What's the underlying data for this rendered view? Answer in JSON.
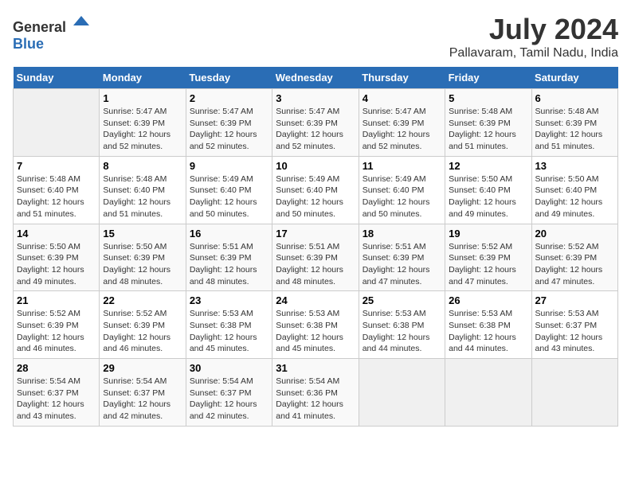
{
  "logo": {
    "general": "General",
    "blue": "Blue"
  },
  "title": {
    "month_year": "July 2024",
    "location": "Pallavaram, Tamil Nadu, India"
  },
  "headers": [
    "Sunday",
    "Monday",
    "Tuesday",
    "Wednesday",
    "Thursday",
    "Friday",
    "Saturday"
  ],
  "weeks": [
    [
      {
        "day": "",
        "info": ""
      },
      {
        "day": "1",
        "info": "Sunrise: 5:47 AM\nSunset: 6:39 PM\nDaylight: 12 hours\nand 52 minutes."
      },
      {
        "day": "2",
        "info": "Sunrise: 5:47 AM\nSunset: 6:39 PM\nDaylight: 12 hours\nand 52 minutes."
      },
      {
        "day": "3",
        "info": "Sunrise: 5:47 AM\nSunset: 6:39 PM\nDaylight: 12 hours\nand 52 minutes."
      },
      {
        "day": "4",
        "info": "Sunrise: 5:47 AM\nSunset: 6:39 PM\nDaylight: 12 hours\nand 52 minutes."
      },
      {
        "day": "5",
        "info": "Sunrise: 5:48 AM\nSunset: 6:39 PM\nDaylight: 12 hours\nand 51 minutes."
      },
      {
        "day": "6",
        "info": "Sunrise: 5:48 AM\nSunset: 6:39 PM\nDaylight: 12 hours\nand 51 minutes."
      }
    ],
    [
      {
        "day": "7",
        "info": "Sunrise: 5:48 AM\nSunset: 6:40 PM\nDaylight: 12 hours\nand 51 minutes."
      },
      {
        "day": "8",
        "info": "Sunrise: 5:48 AM\nSunset: 6:40 PM\nDaylight: 12 hours\nand 51 minutes."
      },
      {
        "day": "9",
        "info": "Sunrise: 5:49 AM\nSunset: 6:40 PM\nDaylight: 12 hours\nand 50 minutes."
      },
      {
        "day": "10",
        "info": "Sunrise: 5:49 AM\nSunset: 6:40 PM\nDaylight: 12 hours\nand 50 minutes."
      },
      {
        "day": "11",
        "info": "Sunrise: 5:49 AM\nSunset: 6:40 PM\nDaylight: 12 hours\nand 50 minutes."
      },
      {
        "day": "12",
        "info": "Sunrise: 5:50 AM\nSunset: 6:40 PM\nDaylight: 12 hours\nand 49 minutes."
      },
      {
        "day": "13",
        "info": "Sunrise: 5:50 AM\nSunset: 6:40 PM\nDaylight: 12 hours\nand 49 minutes."
      }
    ],
    [
      {
        "day": "14",
        "info": "Sunrise: 5:50 AM\nSunset: 6:39 PM\nDaylight: 12 hours\nand 49 minutes."
      },
      {
        "day": "15",
        "info": "Sunrise: 5:50 AM\nSunset: 6:39 PM\nDaylight: 12 hours\nand 48 minutes."
      },
      {
        "day": "16",
        "info": "Sunrise: 5:51 AM\nSunset: 6:39 PM\nDaylight: 12 hours\nand 48 minutes."
      },
      {
        "day": "17",
        "info": "Sunrise: 5:51 AM\nSunset: 6:39 PM\nDaylight: 12 hours\nand 48 minutes."
      },
      {
        "day": "18",
        "info": "Sunrise: 5:51 AM\nSunset: 6:39 PM\nDaylight: 12 hours\nand 47 minutes."
      },
      {
        "day": "19",
        "info": "Sunrise: 5:52 AM\nSunset: 6:39 PM\nDaylight: 12 hours\nand 47 minutes."
      },
      {
        "day": "20",
        "info": "Sunrise: 5:52 AM\nSunset: 6:39 PM\nDaylight: 12 hours\nand 47 minutes."
      }
    ],
    [
      {
        "day": "21",
        "info": "Sunrise: 5:52 AM\nSunset: 6:39 PM\nDaylight: 12 hours\nand 46 minutes."
      },
      {
        "day": "22",
        "info": "Sunrise: 5:52 AM\nSunset: 6:39 PM\nDaylight: 12 hours\nand 46 minutes."
      },
      {
        "day": "23",
        "info": "Sunrise: 5:53 AM\nSunset: 6:38 PM\nDaylight: 12 hours\nand 45 minutes."
      },
      {
        "day": "24",
        "info": "Sunrise: 5:53 AM\nSunset: 6:38 PM\nDaylight: 12 hours\nand 45 minutes."
      },
      {
        "day": "25",
        "info": "Sunrise: 5:53 AM\nSunset: 6:38 PM\nDaylight: 12 hours\nand 44 minutes."
      },
      {
        "day": "26",
        "info": "Sunrise: 5:53 AM\nSunset: 6:38 PM\nDaylight: 12 hours\nand 44 minutes."
      },
      {
        "day": "27",
        "info": "Sunrise: 5:53 AM\nSunset: 6:37 PM\nDaylight: 12 hours\nand 43 minutes."
      }
    ],
    [
      {
        "day": "28",
        "info": "Sunrise: 5:54 AM\nSunset: 6:37 PM\nDaylight: 12 hours\nand 43 minutes."
      },
      {
        "day": "29",
        "info": "Sunrise: 5:54 AM\nSunset: 6:37 PM\nDaylight: 12 hours\nand 42 minutes."
      },
      {
        "day": "30",
        "info": "Sunrise: 5:54 AM\nSunset: 6:37 PM\nDaylight: 12 hours\nand 42 minutes."
      },
      {
        "day": "31",
        "info": "Sunrise: 5:54 AM\nSunset: 6:36 PM\nDaylight: 12 hours\nand 41 minutes."
      },
      {
        "day": "",
        "info": ""
      },
      {
        "day": "",
        "info": ""
      },
      {
        "day": "",
        "info": ""
      }
    ]
  ]
}
